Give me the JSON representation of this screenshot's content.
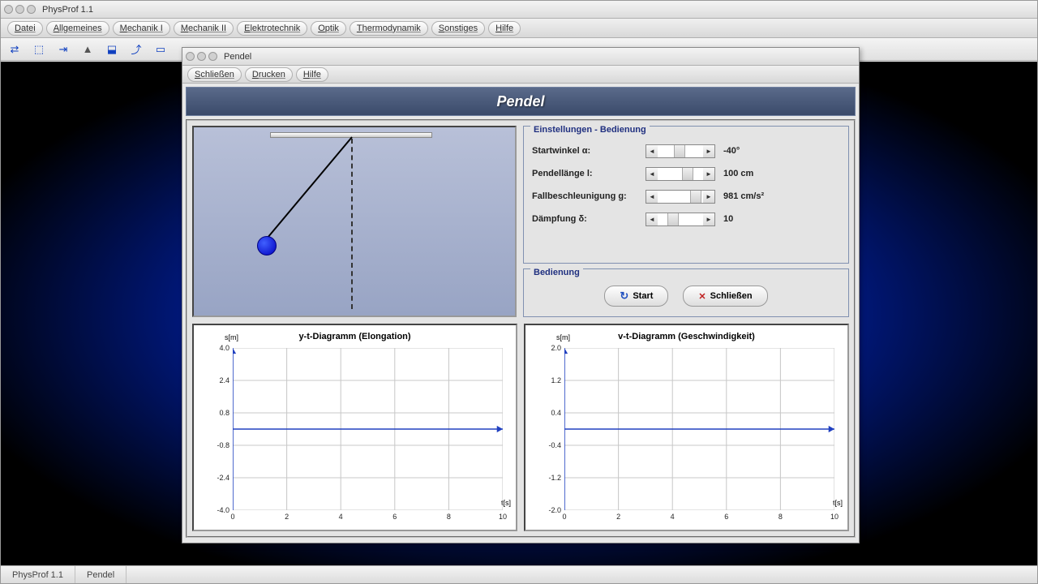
{
  "app": {
    "title": "PhysProf 1.1"
  },
  "menubar": [
    "Datei",
    "Allgemeines",
    "Mechanik I",
    "Mechanik II",
    "Elektrotechnik",
    "Optik",
    "Thermodynamik",
    "Sonstiges",
    "Hilfe"
  ],
  "statusbar": {
    "left": "PhysProf 1.1",
    "right": "Pendel"
  },
  "inner": {
    "title": "Pendel",
    "menubar": [
      "Schließen",
      "Drucken",
      "Hilfe"
    ],
    "banner": "Pendel",
    "settings_legend": "Einstellungen - Bedienung",
    "params": [
      {
        "label": "Startwinkel α:",
        "value": "-40°",
        "thumb": 20
      },
      {
        "label": "Pendellänge l:",
        "value": "100 cm",
        "thumb": 30
      },
      {
        "label": "Fallbeschleunigung g:",
        "value": "981 cm/s²",
        "thumb": 40
      },
      {
        "label": "Dämpfung δ:",
        "value": "10",
        "thumb": 12
      }
    ],
    "controls_legend": "Bedienung",
    "start_label": "Start",
    "close_label": "Schließen"
  },
  "chart_data": [
    {
      "type": "line",
      "title": "y-t-Diagramm (Elongation)",
      "xlabel": "t[s]",
      "ylabel": "s[m]",
      "xlim": [
        0,
        10
      ],
      "ylim": [
        -4.0,
        4.0
      ],
      "xticks": [
        0,
        2,
        4,
        6,
        8,
        10
      ],
      "yticks": [
        -4.0,
        -2.4,
        -0.8,
        0.8,
        2.4,
        4.0
      ],
      "series": [
        {
          "name": "elongation",
          "x": [],
          "y": []
        }
      ]
    },
    {
      "type": "line",
      "title": "v-t-Diagramm (Geschwindigkeit)",
      "xlabel": "t[s]",
      "ylabel": "s[m]",
      "xlim": [
        0,
        10
      ],
      "ylim": [
        -2.0,
        2.0
      ],
      "xticks": [
        0,
        2,
        4,
        6,
        8,
        10
      ],
      "yticks": [
        -2.0,
        -1.2,
        -0.4,
        0.4,
        1.2,
        2.0
      ],
      "series": [
        {
          "name": "velocity",
          "x": [],
          "y": []
        }
      ]
    }
  ]
}
